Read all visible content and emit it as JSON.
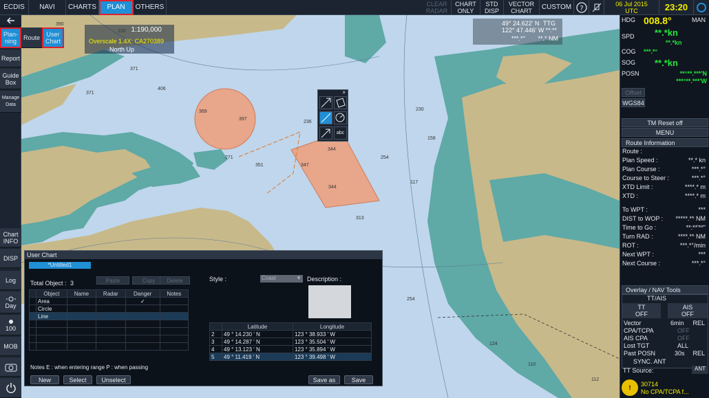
{
  "top_menu": [
    "ECDIS",
    "NAVI",
    "CHARTS",
    "PLAN",
    "OTHERS"
  ],
  "top_right": {
    "clear_radar": "CLEAR RADAR",
    "chart_only": "CHART ONLY",
    "std_disp": "STD DISP",
    "vector_chart": "VECTOR CHART",
    "custom": "CUSTOM",
    "date": "06 Jul 2015",
    "tz": "UTC",
    "time": "23:20"
  },
  "left_buttons": [
    "Plan-ning",
    "Report",
    "Guide Box",
    "Manage Data",
    "Chart INFO",
    "DISP",
    "Log",
    "Day",
    "100",
    "MOB"
  ],
  "left_icons": {
    "back": "back-arrow-icon",
    "day": "sun-icon",
    "camera": "camera-icon",
    "power": "power-icon"
  },
  "chart_tabs": {
    "route": "Route",
    "user_chart": "User Chart"
  },
  "scale_box": {
    "scale": "1:190,000",
    "overscale": "Overscale 1.4X: CA270389",
    "orientation": "North Up"
  },
  "cursor_box": {
    "lat": "49° 24.622' N",
    "lon": "122° 47.446' W",
    "ttg_label": "TTG",
    "ttg_val": "**:**",
    "range_val": "***.*°",
    "nm_val": "**.* NM"
  },
  "depths": [
    "390",
    "56",
    "82",
    "172",
    "172",
    "232",
    "51",
    "107",
    "415",
    "371",
    "379",
    "265",
    "219",
    "212",
    "219",
    "148",
    "140",
    "406",
    "370",
    "371",
    "371",
    "292",
    "272",
    "386",
    "397",
    "369",
    "236",
    "221",
    "271",
    "272",
    "141",
    "130",
    "84",
    "49",
    "155",
    "159",
    "351",
    "333",
    "344",
    "347",
    "344",
    "254",
    "230",
    "158",
    "139",
    "35",
    "121",
    "313",
    "212",
    "214",
    "214",
    "117",
    "252",
    "16",
    "218",
    "218",
    "243",
    "121",
    "156",
    "254",
    "229",
    "124",
    "134",
    "110",
    "119",
    "126",
    "112",
    "148"
  ],
  "right": {
    "hdg_label": "HDG",
    "hdg_val": "008.8°",
    "hdg_mode": "MAN",
    "spd_label": "SPD",
    "spd_val": "**.*kn",
    "spd_sub": "**.*kn",
    "cog_label": "COG",
    "cog_val": "***.*°",
    "sog_label": "SOG",
    "sog_val": "**.*kn",
    "posn_label": "POSN",
    "posn_lat": "**°**.***'N",
    "posn_lon": "***°**.***'W",
    "offset": "Offset",
    "datum": "WGS84",
    "tm_reset": "TM Reset off",
    "menu": "MENU",
    "route_info_title": "Route Information",
    "route_rows": [
      {
        "k": "Route :",
        "v": ""
      },
      {
        "k": "Plan Speed :",
        "v": "**.* kn"
      },
      {
        "k": "Plan Course :",
        "v": "***.*°"
      },
      {
        "k": "Course to Steer :",
        "v": "***.*°"
      },
      {
        "k": "XTD Limit :",
        "v": "****.* m"
      },
      {
        "k": "XTD :",
        "v": "****.* m"
      },
      {
        "k": "To WPT :",
        "v": "***"
      },
      {
        "k": "DIST to WOP :",
        "v": "*****.** NM"
      },
      {
        "k": "Time to Go :",
        "v": "**:**'**\""
      },
      {
        "k": "Turn RAD :",
        "v": "****.** NM"
      },
      {
        "k": "ROT :",
        "v": "***.*°/min"
      },
      {
        "k": "Next WPT :",
        "v": "***"
      },
      {
        "k": "Next Course :",
        "v": "***.*°"
      }
    ],
    "overlay_title": "Overlay / NAV Tools",
    "tt_ais": "TT/AIS",
    "tt_label": "TT",
    "tt_state": "OFF",
    "ais_label": "AIS",
    "ais_state": "OFF",
    "vector_label": "Vector",
    "vector_val": "6min",
    "vector_mode": "REL",
    "cpa_label": "CPA/TCPA",
    "cpa_val": "OFF",
    "ais_cpa_label": "AIS CPA",
    "ais_cpa_val": "OFF",
    "lost_label": "Lost TGT",
    "lost_val": "ALL",
    "past_label": "Past POSN",
    "past_val": "30s",
    "past_mode": "REL",
    "sync_ant": "SYNC. ANT",
    "tt_source": "TT Source:",
    "ant": "ANT",
    "alarm_code": "30714",
    "alarm_text": "No CPA/TCPA f..."
  },
  "user_chart": {
    "title": "User Chart",
    "tab": "*Untitled1",
    "total_label": "Total Object :",
    "total_val": "3",
    "paste": "Paste",
    "copy": "Copy",
    "delete": "Delete",
    "headers": [
      "Object",
      "Name",
      "Radar",
      "Danger",
      "Notes"
    ],
    "objects": [
      {
        "obj": "Area",
        "danger": "✓"
      },
      {
        "obj": "Circle",
        "danger": ""
      },
      {
        "obj": "Line",
        "danger": ""
      }
    ],
    "style_label": "Style :",
    "style_val": "Coast",
    "desc_label": "Description :",
    "coord_headers": [
      "",
      "Latitude",
      "Longitude"
    ],
    "coords": [
      {
        "n": "2",
        "lat": "49 ° 14.230 ' N",
        "lon": "123 ° 38.933 ' W"
      },
      {
        "n": "3",
        "lat": "49 ° 14.287 ' N",
        "lon": "123 ° 35.504 ' W"
      },
      {
        "n": "4",
        "lat": "49 ° 13.123 ' N",
        "lon": "123 ° 35.894 ' W"
      },
      {
        "n": "5",
        "lat": "49 ° 11.419 ' N",
        "lon": "123 ° 39.498 ' W"
      }
    ],
    "notes": "Notes  E : when entering range  P : when passing",
    "new": "New",
    "select": "Select",
    "unselect": "Unselect",
    "save_as": "Save as",
    "save": "Save"
  },
  "colors": {
    "sea": "#bfd6ec",
    "land": "#c8b98a",
    "shallow": "#5fa9a6",
    "danger_area": "#e8a68a",
    "accent": "#1f8fd6"
  }
}
